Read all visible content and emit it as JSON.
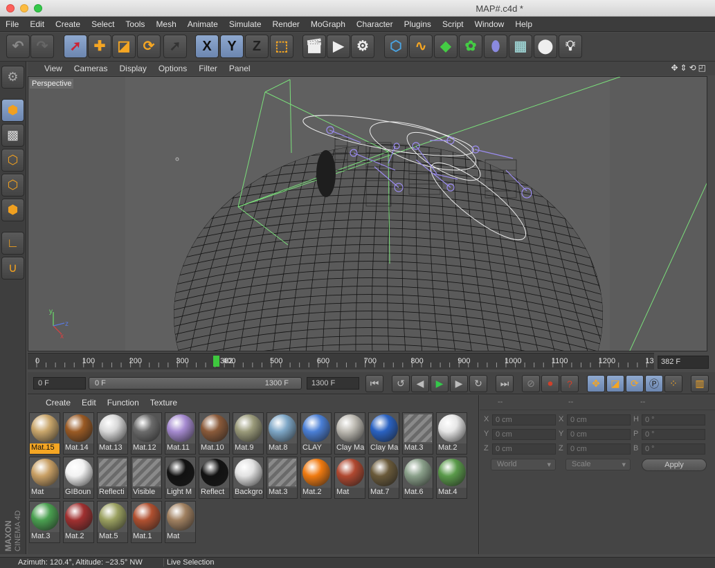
{
  "window": {
    "title": "MAP#.c4d *"
  },
  "menu": [
    "File",
    "Edit",
    "Create",
    "Select",
    "Tools",
    "Mesh",
    "Animate",
    "Simulate",
    "Render",
    "MoGraph",
    "Character",
    "Plugins",
    "Script",
    "Window",
    "Help"
  ],
  "toolbar": {
    "axis_x": "X",
    "axis_y": "Y",
    "axis_z": "Z"
  },
  "viewport": {
    "menu": [
      "View",
      "Cameras",
      "Display",
      "Options",
      "Filter",
      "Panel"
    ],
    "label": "Perspective",
    "axes": {
      "x": "x",
      "y": "y",
      "z": "z"
    }
  },
  "timeline": {
    "ticks": [
      "0",
      "100",
      "200",
      "300",
      "400",
      "500",
      "600",
      "700",
      "800",
      "900",
      "1000",
      "1100",
      "1200",
      "130"
    ],
    "current_marker": "382",
    "current_frame": "382 F",
    "start_field": "0 F",
    "range_start": "0 F",
    "range_end": "1300 F",
    "end_field": "1300 F"
  },
  "materials": {
    "menu": [
      "Create",
      "Edit",
      "Function",
      "Texture"
    ],
    "items": [
      {
        "name": "Mat.15",
        "active": true,
        "color": "#c9a66b"
      },
      {
        "name": "Mat.14",
        "color": "#9a5a24"
      },
      {
        "name": "Mat.13",
        "color": "#d8d8d8"
      },
      {
        "name": "Mat.12",
        "color": "#6b6b6b"
      },
      {
        "name": "Mat.11",
        "color": "#a58ad0"
      },
      {
        "name": "Mat.10",
        "color": "#8a5a3a"
      },
      {
        "name": "Mat.9",
        "color": "#9a9a7a"
      },
      {
        "name": "Mat.8",
        "color": "#7ea7c7"
      },
      {
        "name": "CLAY",
        "color": "#4a7fd6"
      },
      {
        "name": "Clay Ma",
        "color": "#bdbab2"
      },
      {
        "name": "Clay Ma",
        "color": "#2a62c2"
      },
      {
        "name": "Mat.3",
        "stripe": true
      },
      {
        "name": "Mat.2",
        "color": "#e6e6e6"
      },
      {
        "name": "Mat",
        "color": "#c9a065"
      },
      {
        "name": "GIBoun",
        "color": "#f2f2f2"
      },
      {
        "name": "Reflecti",
        "stripe": true
      },
      {
        "name": "Visible",
        "stripe": true
      },
      {
        "name": "Light M",
        "color": "#111111"
      },
      {
        "name": "Reflect",
        "color": "#111111"
      },
      {
        "name": "Backgro",
        "color": "#e2e2e2"
      },
      {
        "name": "Mat.3",
        "stripe": true
      },
      {
        "name": "Mat.2",
        "color": "#f07a10"
      },
      {
        "name": "Mat",
        "color": "#b04830"
      },
      {
        "name": "Mat.7",
        "color": "#6a5a3a"
      },
      {
        "name": "Mat.6",
        "color": "#8aa08a"
      },
      {
        "name": "Mat.4",
        "color": "#5a9a4a"
      },
      {
        "name": "Mat.3",
        "color": "#4aa050"
      },
      {
        "name": "Mat.2",
        "color": "#a03030"
      },
      {
        "name": "Mat.5",
        "color": "#9aa060"
      },
      {
        "name": "Mat.1",
        "color": "#b05030"
      },
      {
        "name": "Mat",
        "color": "#a08060"
      }
    ]
  },
  "coordinates": {
    "headers": [
      "--",
      "--",
      "--"
    ],
    "rows": [
      {
        "l1": "X",
        "v1": "0 cm",
        "l2": "X",
        "v2": "0 cm",
        "l3": "H",
        "v3": "0 °"
      },
      {
        "l1": "Y",
        "v1": "0 cm",
        "l2": "Y",
        "v2": "0 cm",
        "l3": "P",
        "v3": "0 °"
      },
      {
        "l1": "Z",
        "v1": "0 cm",
        "l2": "Z",
        "v2": "0 cm",
        "l3": "B",
        "v3": "0 °"
      }
    ],
    "mode": "World",
    "size_mode": "Scale",
    "apply": "Apply"
  },
  "status": {
    "text": "Azimuth: 120.4°, Altitude: −23.5°  NW",
    "tool": "Live Selection"
  },
  "colors": {
    "accent": "#f5a623",
    "selected": "#7a94bd",
    "play": "#34c84a",
    "record": "#d0402a"
  }
}
